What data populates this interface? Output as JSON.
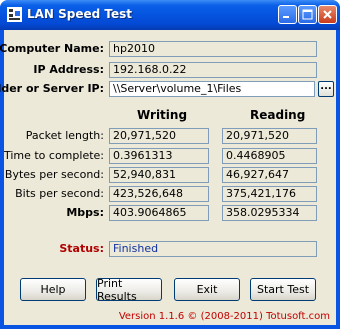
{
  "window": {
    "title": "LAN Speed Test"
  },
  "computer_name": {
    "label": "Computer Name:",
    "value": "hp2010"
  },
  "ip_address": {
    "label": "IP Address:",
    "value": "192.168.0.22"
  },
  "folder": {
    "label": "Folder or Server IP:",
    "value": "\\\\Server\\volume_1\\Files",
    "browse_label": "..."
  },
  "columns": {
    "writing": "Writing",
    "reading": "Reading"
  },
  "rows": [
    {
      "label": "Packet length:",
      "writing": "20,971,520",
      "reading": "20,971,520"
    },
    {
      "label": "Time to complete:",
      "writing": "0.3961313",
      "reading": "0.4468905"
    },
    {
      "label": "Bytes per second:",
      "writing": "52,940,831",
      "reading": "46,927,647"
    },
    {
      "label": "Bits per second:",
      "writing": "423,526,648",
      "reading": "375,421,176"
    },
    {
      "label": "Mbps:",
      "writing": "403.9064865",
      "reading": "358.0295334"
    }
  ],
  "status": {
    "label": "Status:",
    "value": "Finished"
  },
  "buttons": {
    "help": "Help",
    "print": "Print Results",
    "exit": "Exit",
    "start": "Start Test"
  },
  "footer": {
    "version": "Version 1.1.6  © (2008-2011) Totusoft.com"
  },
  "colors": {
    "titlebar": "#0554e0",
    "status_label": "#b00000",
    "status_value": "#1030a0",
    "face": "#ece9d8"
  }
}
